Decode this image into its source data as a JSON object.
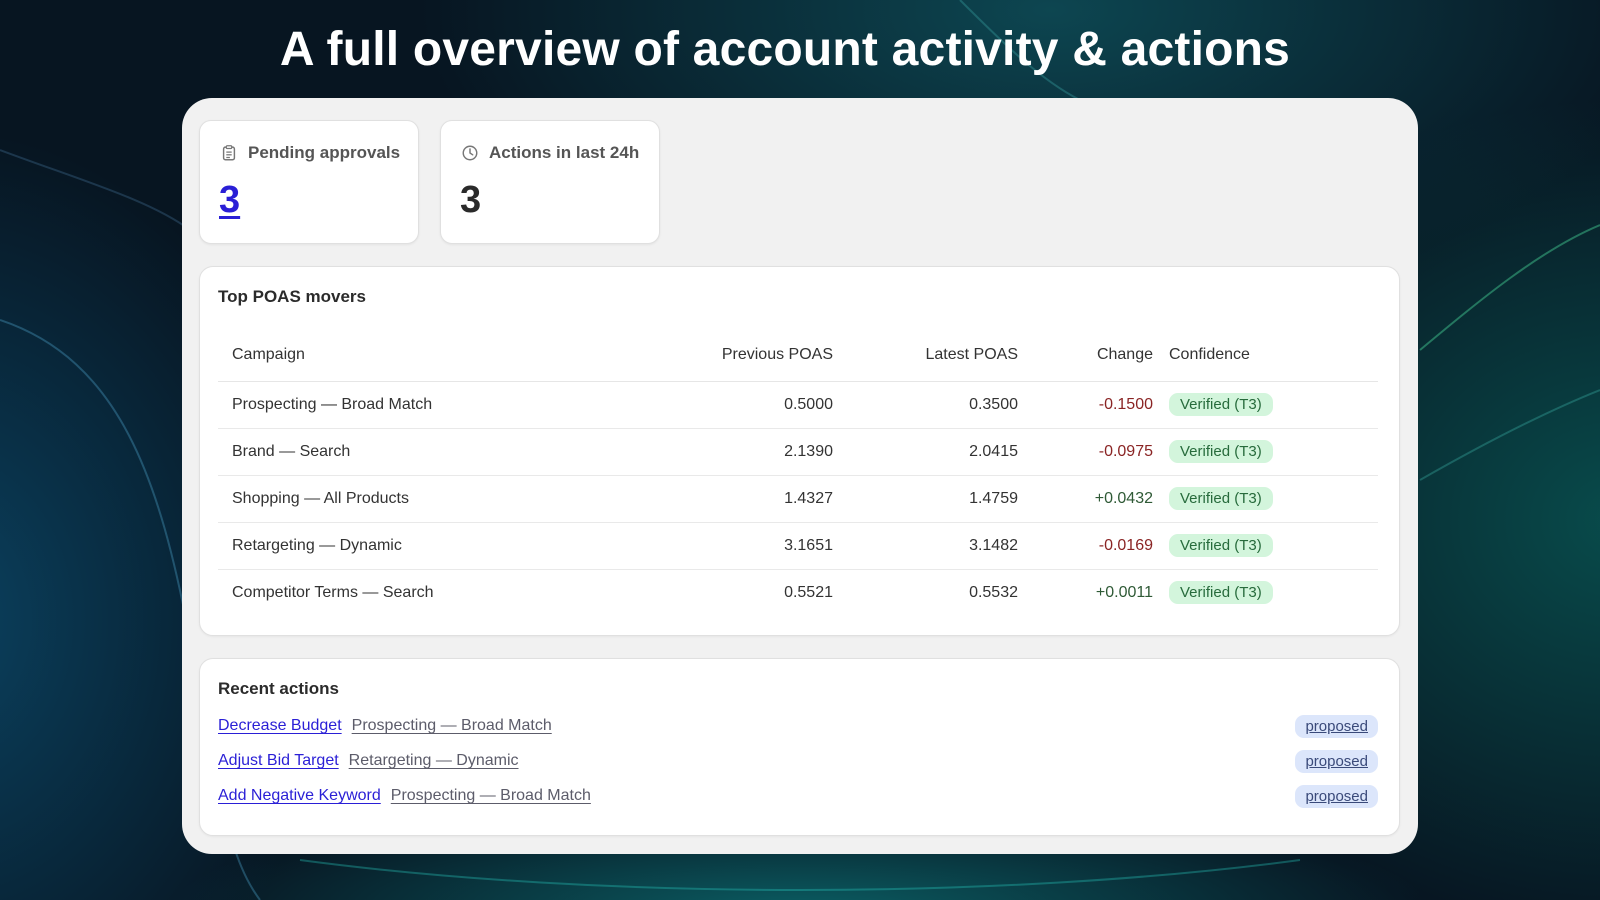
{
  "headline": "A full overview of account activity & actions",
  "colors": {
    "accent_link": "#2a1fd6",
    "negative": "#8a2424",
    "positive": "#2f5a36",
    "badge_bg": "#d3f5dc",
    "pill_bg": "#dce6fb"
  },
  "stats": [
    {
      "icon": "clipboard-icon",
      "label": "Pending approvals",
      "value": "3"
    },
    {
      "icon": "clock-icon",
      "label": "Actions in last 24h",
      "value": "3"
    }
  ],
  "movers": {
    "title": "Top POAS movers",
    "columns": [
      "Campaign",
      "Previous POAS",
      "Latest POAS",
      "Change",
      "Confidence"
    ],
    "rows": [
      {
        "campaign": "Prospecting — Broad Match",
        "previous": "0.5000",
        "latest": "0.3500",
        "change": "-0.1500",
        "confidence": "Verified (T3)"
      },
      {
        "campaign": "Brand — Search",
        "previous": "2.1390",
        "latest": "2.0415",
        "change": "-0.0975",
        "confidence": "Verified (T3)"
      },
      {
        "campaign": "Shopping — All Products",
        "previous": "1.4327",
        "latest": "1.4759",
        "change": "+0.0432",
        "confidence": "Verified (T3)"
      },
      {
        "campaign": "Retargeting — Dynamic",
        "previous": "3.1651",
        "latest": "3.1482",
        "change": "-0.0169",
        "confidence": "Verified (T3)"
      },
      {
        "campaign": "Competitor Terms — Search",
        "previous": "0.5521",
        "latest": "0.5532",
        "change": "+0.0011",
        "confidence": "Verified (T3)"
      }
    ]
  },
  "recent": {
    "title": "Recent actions",
    "items": [
      {
        "action": "Decrease Budget",
        "target": "Prospecting — Broad Match",
        "status": "proposed"
      },
      {
        "action": "Adjust Bid Target",
        "target": "Retargeting — Dynamic",
        "status": "proposed"
      },
      {
        "action": "Add Negative Keyword",
        "target": "Prospecting — Broad Match",
        "status": "proposed"
      }
    ]
  }
}
